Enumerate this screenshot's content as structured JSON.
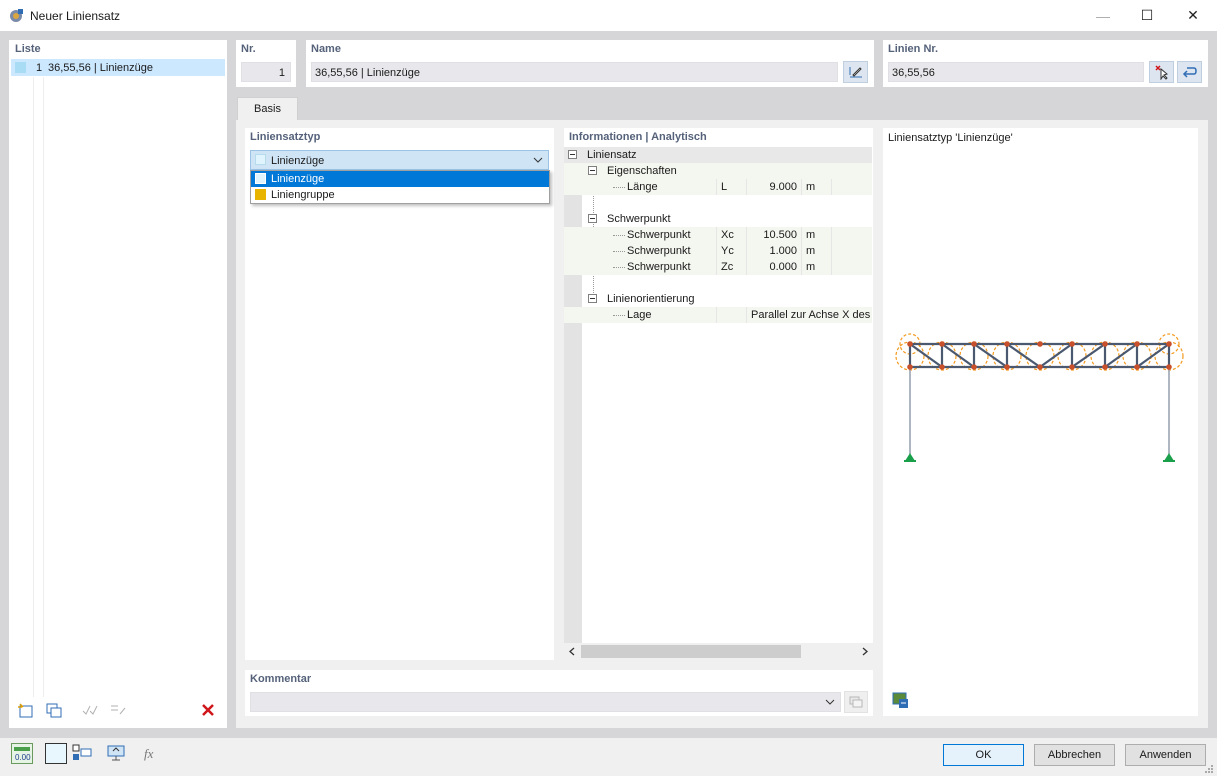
{
  "window": {
    "title": "Neuer Liniensatz",
    "minimize": "—",
    "maximize": "☐",
    "close": "✕"
  },
  "list_panel": {
    "header": "Liste",
    "items": [
      {
        "num": "1",
        "label": "36,55,56 | Linienzüge"
      }
    ]
  },
  "nr": {
    "label": "Nr.",
    "value": "1"
  },
  "name": {
    "label": "Name",
    "value": "36,55,56 | Linienzüge"
  },
  "lines": {
    "label": "Linien Nr.",
    "value": "36,55,56"
  },
  "tabs": [
    "Basis"
  ],
  "type_section": {
    "header": "Liniensatztyp",
    "selected": "Linienzüge",
    "options": [
      {
        "label": "Linienzüge",
        "color": "#bfe6f6"
      },
      {
        "label": "Liniengruppe",
        "color": "#e8b400"
      }
    ]
  },
  "info": {
    "header": "Informationen | Analytisch",
    "root": "Liniensatz",
    "eigenschaften": {
      "label": "Eigenschaften",
      "rows": [
        {
          "name": "Länge",
          "sym": "L",
          "value": "9.000",
          "unit": "m"
        }
      ]
    },
    "schwerpunkt": {
      "label": "Schwerpunkt",
      "rows": [
        {
          "name": "Schwerpunkt",
          "sym": "Xc",
          "value": "10.500",
          "unit": "m"
        },
        {
          "name": "Schwerpunkt",
          "sym": "Yc",
          "value": "1.000",
          "unit": "m"
        },
        {
          "name": "Schwerpunkt",
          "sym": "Zc",
          "value": "0.000",
          "unit": "m"
        }
      ]
    },
    "orientierung": {
      "label": "Linienorientierung",
      "rows": [
        {
          "name": "Lage",
          "value": "Parallel zur Achse X des"
        }
      ]
    }
  },
  "preview": {
    "title": "Liniensatztyp 'Linienzüge'"
  },
  "comment": {
    "label": "Kommentar",
    "value": ""
  },
  "buttons": {
    "ok": "OK",
    "cancel": "Abbrechen",
    "apply": "Anwenden"
  },
  "colors": {
    "accent": "#0078d7",
    "header_text": "#55627a",
    "truss_line": "#4a5870",
    "node": "#c8502a",
    "support": "#1aa04b",
    "highlight": "#f39a1e"
  }
}
